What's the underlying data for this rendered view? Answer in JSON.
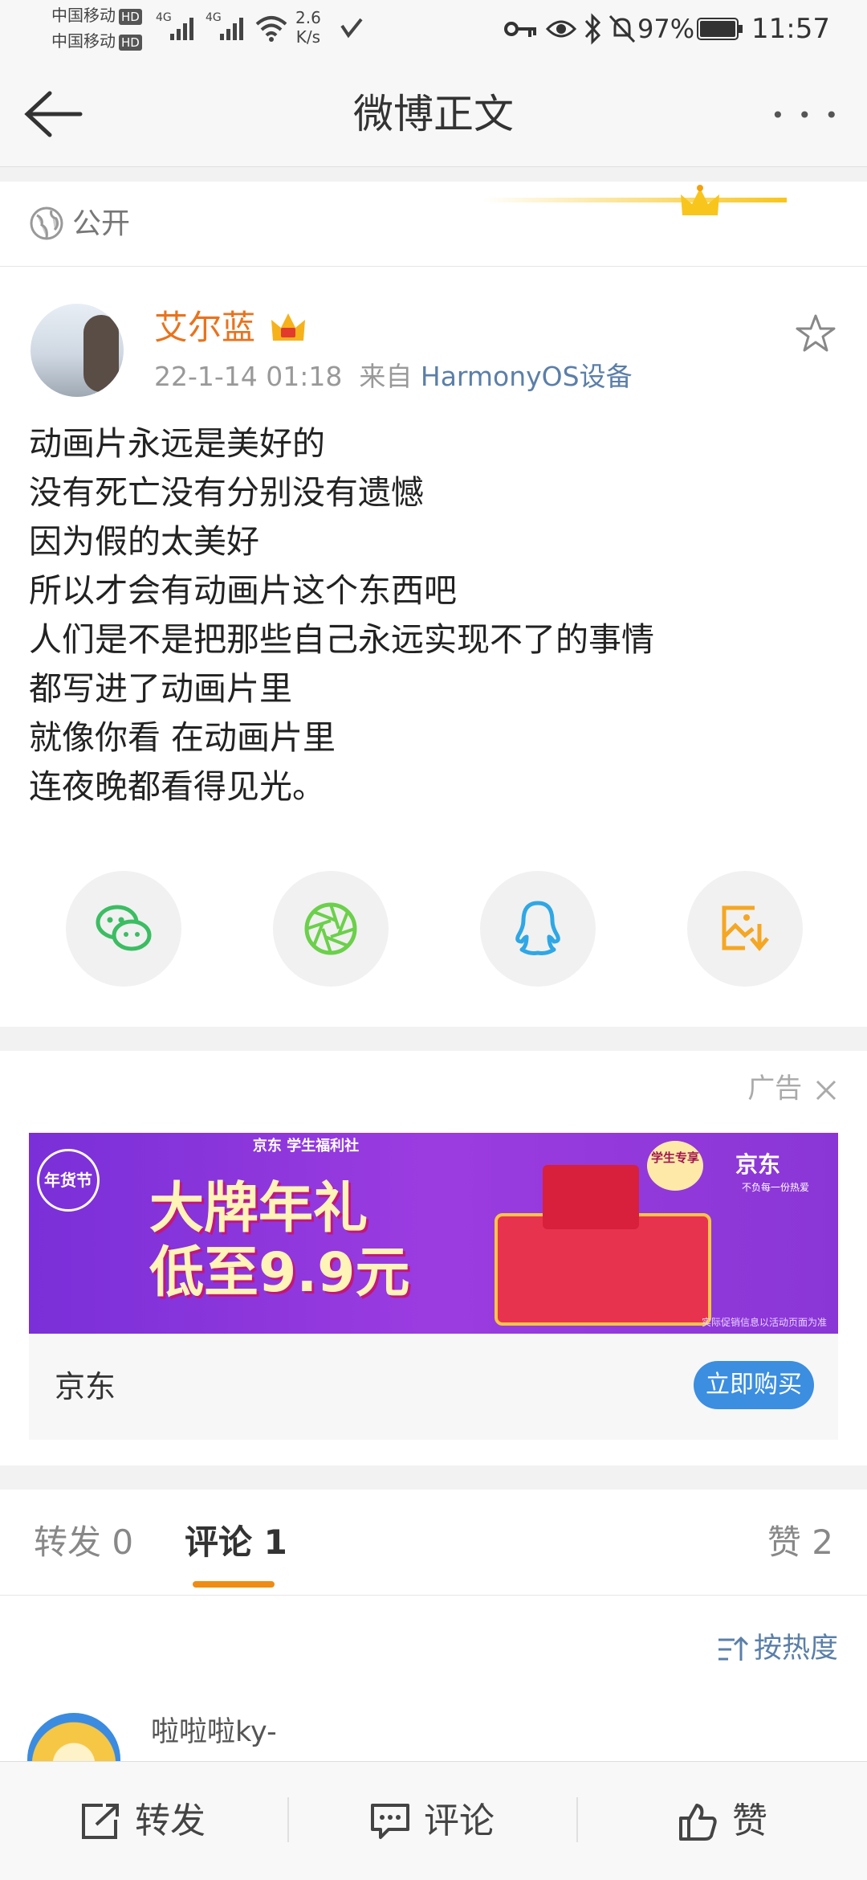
{
  "status_bar": {
    "carrier1": "中国移动",
    "carrier2": "中国移动",
    "hd": "HD",
    "net1": "4G",
    "net2": "4G",
    "speed_value": "2.6",
    "speed_unit": "K/s",
    "battery": "97%",
    "time": "11:57"
  },
  "nav": {
    "title": "微博正文",
    "more": "• • •"
  },
  "visibility": {
    "label": "公开"
  },
  "post": {
    "username": "艾尔蓝",
    "time": "22-1-14 01:18",
    "from_label": "来自",
    "source": "HarmonyOS设备",
    "lines": [
      "动画片永远是美好的",
      "没有死亡没有分别没有遗憾",
      "因为假的太美好",
      "所以才会有动画片这个东西吧",
      "人们是不是把那些自己永远实现不了的事情",
      "都写进了动画片里",
      "就像你看 在动画片里",
      "连夜晚都看得见光。"
    ]
  },
  "ad": {
    "tag": "广告",
    "banner_badge": "年货节",
    "banner_sub": "京东 学生福利社",
    "banner_line1": "大牌年礼",
    "banner_line2": "低至9.9元",
    "banner_logo": "京东",
    "banner_slogan": "不负每一份热爱",
    "student_badge": "学生专享",
    "banner_note": "实际促销信息以活动页面为准",
    "brand": "京东",
    "buy_label": "立即购买"
  },
  "tabs": {
    "repost": "转发 0",
    "comment": "评论 1",
    "like": "赞 2"
  },
  "comments": {
    "sort_label": "按热度",
    "first_user": "啦啦啦ky-"
  },
  "bottom_bar": {
    "repost": "转发",
    "comment": "评论",
    "like": "赞"
  },
  "colors": {
    "username": "#e8731d",
    "link": "#5b7fa8",
    "accent": "#f08b14",
    "buy_button": "#3b8ee0"
  }
}
